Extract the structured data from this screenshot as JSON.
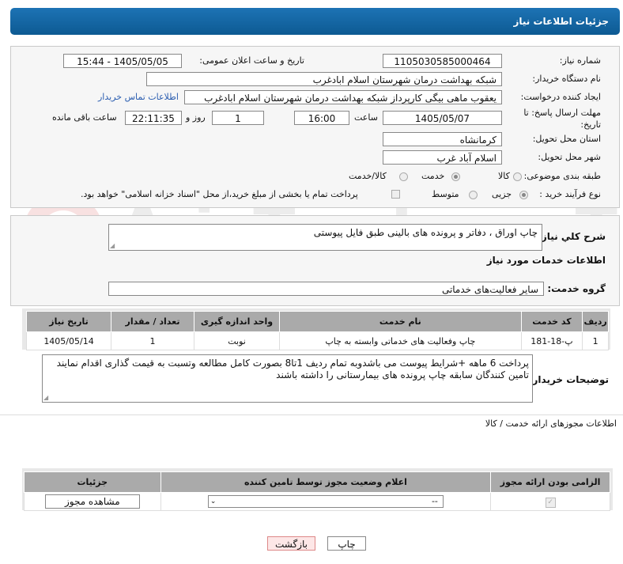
{
  "header": {
    "title": "جزئیات اطلاعات نیاز"
  },
  "watermark": "AriaTender.neT",
  "form": {
    "need_number_label": "شماره نیاز:",
    "need_number": "1105030585000464",
    "announce_label": "تاریخ و ساعت اعلان عمومی:",
    "announce_value": "1405/05/05 - 15:44",
    "buyer_org_label": "نام دستگاه خریدار:",
    "buyer_org": "شبکه بهداشت درمان شهرستان اسلام ابادغرب",
    "creator_label": "ایجاد کننده درخواست:",
    "creator": "یعقوب ماهی بیگی کارپرداز شبکه بهداشت درمان شهرستان اسلام ابادغرب",
    "contact_link": "اطلاعات تماس خریدار",
    "deadline_label_line1": "مهلت ارسال پاسخ: تا",
    "deadline_label_line2": "تاریخ:",
    "deadline_date": "1405/05/07",
    "time_label": "ساعت",
    "deadline_time": "16:00",
    "days_value": "1",
    "days_label": "روز و",
    "remaining_time": "22:11:35",
    "remaining_label": "ساعت باقی مانده",
    "province_label": "استان محل تحویل:",
    "province": "کرمانشاه",
    "city_label": "شهر محل تحویل:",
    "city": "اسلام آباد غرب",
    "category_label": "طبقه بندی موضوعی:",
    "category_options": [
      "کالا",
      "خدمت",
      "کالا/خدمت"
    ],
    "category_selected": "خدمت",
    "process_label": "نوع فرآیند خرید :",
    "process_options": [
      "جزیی",
      "متوسط"
    ],
    "process_selected": "جزیی",
    "payment_note": "پرداخت تمام یا بخشی از مبلغ خرید،از محل \"اسناد خزانه اسلامی\" خواهد بود."
  },
  "summary": {
    "label": "شرح کلي نياز:",
    "value": "چاپ اوراق ، دفاتر و پرونده های بالینی طبق فایل پیوستی"
  },
  "services_section": {
    "title": "اطلاعات خدمات مورد نیاز",
    "group_label": "گروه خدمت:",
    "group_value": "سایر فعالیت‌های خدماتی",
    "columns": [
      "ردیف",
      "کد خدمت",
      "نام خدمت",
      "واحد اندازه گیری",
      "تعداد / مقدار",
      "تاریخ نیاز"
    ],
    "rows": [
      [
        "1",
        "پ-18-181",
        "چاپ وفعالیت های خدماتی وابسته به چاپ",
        "نوبت",
        "1",
        "1405/05/14"
      ]
    ]
  },
  "buyer_notes": {
    "label": "توضیحات خریدار:",
    "value": "پرداخت 6 ماهه +شرایط پیوست می باشدوبه تمام ردیف 1تا8 بصورت کامل مطالعه وتسبت به قیمت گذاری اقدام نمایند تامین کنندگان سابقه چاپ  پرونده های بیمارستانی را داشته باشند"
  },
  "permits": {
    "title": "اطلاعات مجوزهای ارائه خدمت / کالا",
    "columns": [
      "الزامی بودن ارائه مجوز",
      "اعلام وضعیت مجوز توسط تامین کننده",
      "جزئیات"
    ],
    "select_value": "--",
    "view_button": "مشاهده مجوز"
  },
  "footer": {
    "print": "چاپ",
    "back": "بازگشت"
  }
}
